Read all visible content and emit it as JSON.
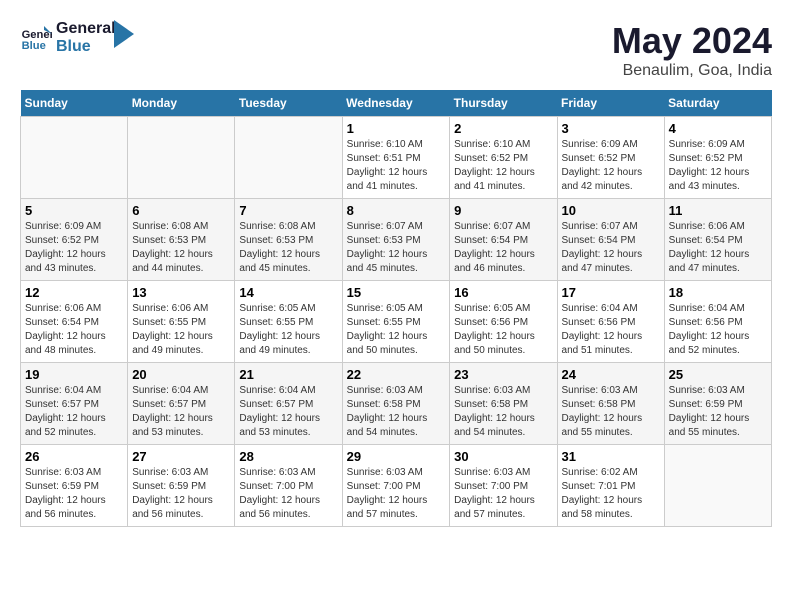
{
  "logo": {
    "text_general": "General",
    "text_blue": "Blue"
  },
  "title": {
    "month_year": "May 2024",
    "location": "Benaulim, Goa, India"
  },
  "headers": [
    "Sunday",
    "Monday",
    "Tuesday",
    "Wednesday",
    "Thursday",
    "Friday",
    "Saturday"
  ],
  "weeks": [
    [
      {
        "day": "",
        "sunrise": "",
        "sunset": "",
        "daylight": ""
      },
      {
        "day": "",
        "sunrise": "",
        "sunset": "",
        "daylight": ""
      },
      {
        "day": "",
        "sunrise": "",
        "sunset": "",
        "daylight": ""
      },
      {
        "day": "1",
        "sunrise": "Sunrise: 6:10 AM",
        "sunset": "Sunset: 6:51 PM",
        "daylight": "Daylight: 12 hours and 41 minutes."
      },
      {
        "day": "2",
        "sunrise": "Sunrise: 6:10 AM",
        "sunset": "Sunset: 6:52 PM",
        "daylight": "Daylight: 12 hours and 41 minutes."
      },
      {
        "day": "3",
        "sunrise": "Sunrise: 6:09 AM",
        "sunset": "Sunset: 6:52 PM",
        "daylight": "Daylight: 12 hours and 42 minutes."
      },
      {
        "day": "4",
        "sunrise": "Sunrise: 6:09 AM",
        "sunset": "Sunset: 6:52 PM",
        "daylight": "Daylight: 12 hours and 43 minutes."
      }
    ],
    [
      {
        "day": "5",
        "sunrise": "Sunrise: 6:09 AM",
        "sunset": "Sunset: 6:52 PM",
        "daylight": "Daylight: 12 hours and 43 minutes."
      },
      {
        "day": "6",
        "sunrise": "Sunrise: 6:08 AM",
        "sunset": "Sunset: 6:53 PM",
        "daylight": "Daylight: 12 hours and 44 minutes."
      },
      {
        "day": "7",
        "sunrise": "Sunrise: 6:08 AM",
        "sunset": "Sunset: 6:53 PM",
        "daylight": "Daylight: 12 hours and 45 minutes."
      },
      {
        "day": "8",
        "sunrise": "Sunrise: 6:07 AM",
        "sunset": "Sunset: 6:53 PM",
        "daylight": "Daylight: 12 hours and 45 minutes."
      },
      {
        "day": "9",
        "sunrise": "Sunrise: 6:07 AM",
        "sunset": "Sunset: 6:54 PM",
        "daylight": "Daylight: 12 hours and 46 minutes."
      },
      {
        "day": "10",
        "sunrise": "Sunrise: 6:07 AM",
        "sunset": "Sunset: 6:54 PM",
        "daylight": "Daylight: 12 hours and 47 minutes."
      },
      {
        "day": "11",
        "sunrise": "Sunrise: 6:06 AM",
        "sunset": "Sunset: 6:54 PM",
        "daylight": "Daylight: 12 hours and 47 minutes."
      }
    ],
    [
      {
        "day": "12",
        "sunrise": "Sunrise: 6:06 AM",
        "sunset": "Sunset: 6:54 PM",
        "daylight": "Daylight: 12 hours and 48 minutes."
      },
      {
        "day": "13",
        "sunrise": "Sunrise: 6:06 AM",
        "sunset": "Sunset: 6:55 PM",
        "daylight": "Daylight: 12 hours and 49 minutes."
      },
      {
        "day": "14",
        "sunrise": "Sunrise: 6:05 AM",
        "sunset": "Sunset: 6:55 PM",
        "daylight": "Daylight: 12 hours and 49 minutes."
      },
      {
        "day": "15",
        "sunrise": "Sunrise: 6:05 AM",
        "sunset": "Sunset: 6:55 PM",
        "daylight": "Daylight: 12 hours and 50 minutes."
      },
      {
        "day": "16",
        "sunrise": "Sunrise: 6:05 AM",
        "sunset": "Sunset: 6:56 PM",
        "daylight": "Daylight: 12 hours and 50 minutes."
      },
      {
        "day": "17",
        "sunrise": "Sunrise: 6:04 AM",
        "sunset": "Sunset: 6:56 PM",
        "daylight": "Daylight: 12 hours and 51 minutes."
      },
      {
        "day": "18",
        "sunrise": "Sunrise: 6:04 AM",
        "sunset": "Sunset: 6:56 PM",
        "daylight": "Daylight: 12 hours and 52 minutes."
      }
    ],
    [
      {
        "day": "19",
        "sunrise": "Sunrise: 6:04 AM",
        "sunset": "Sunset: 6:57 PM",
        "daylight": "Daylight: 12 hours and 52 minutes."
      },
      {
        "day": "20",
        "sunrise": "Sunrise: 6:04 AM",
        "sunset": "Sunset: 6:57 PM",
        "daylight": "Daylight: 12 hours and 53 minutes."
      },
      {
        "day": "21",
        "sunrise": "Sunrise: 6:04 AM",
        "sunset": "Sunset: 6:57 PM",
        "daylight": "Daylight: 12 hours and 53 minutes."
      },
      {
        "day": "22",
        "sunrise": "Sunrise: 6:03 AM",
        "sunset": "Sunset: 6:58 PM",
        "daylight": "Daylight: 12 hours and 54 minutes."
      },
      {
        "day": "23",
        "sunrise": "Sunrise: 6:03 AM",
        "sunset": "Sunset: 6:58 PM",
        "daylight": "Daylight: 12 hours and 54 minutes."
      },
      {
        "day": "24",
        "sunrise": "Sunrise: 6:03 AM",
        "sunset": "Sunset: 6:58 PM",
        "daylight": "Daylight: 12 hours and 55 minutes."
      },
      {
        "day": "25",
        "sunrise": "Sunrise: 6:03 AM",
        "sunset": "Sunset: 6:59 PM",
        "daylight": "Daylight: 12 hours and 55 minutes."
      }
    ],
    [
      {
        "day": "26",
        "sunrise": "Sunrise: 6:03 AM",
        "sunset": "Sunset: 6:59 PM",
        "daylight": "Daylight: 12 hours and 56 minutes."
      },
      {
        "day": "27",
        "sunrise": "Sunrise: 6:03 AM",
        "sunset": "Sunset: 6:59 PM",
        "daylight": "Daylight: 12 hours and 56 minutes."
      },
      {
        "day": "28",
        "sunrise": "Sunrise: 6:03 AM",
        "sunset": "Sunset: 7:00 PM",
        "daylight": "Daylight: 12 hours and 56 minutes."
      },
      {
        "day": "29",
        "sunrise": "Sunrise: 6:03 AM",
        "sunset": "Sunset: 7:00 PM",
        "daylight": "Daylight: 12 hours and 57 minutes."
      },
      {
        "day": "30",
        "sunrise": "Sunrise: 6:03 AM",
        "sunset": "Sunset: 7:00 PM",
        "daylight": "Daylight: 12 hours and 57 minutes."
      },
      {
        "day": "31",
        "sunrise": "Sunrise: 6:02 AM",
        "sunset": "Sunset: 7:01 PM",
        "daylight": "Daylight: 12 hours and 58 minutes."
      },
      {
        "day": "",
        "sunrise": "",
        "sunset": "",
        "daylight": ""
      }
    ]
  ]
}
